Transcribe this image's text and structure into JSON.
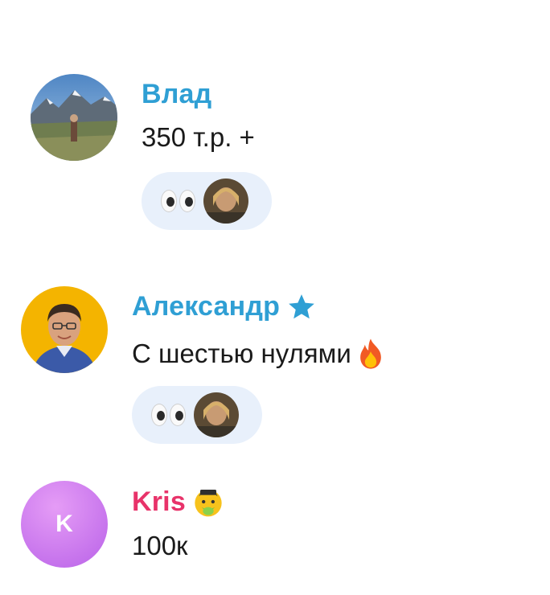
{
  "colors": {
    "name_blue": "#2f9fd4",
    "name_pink": "#e8336a",
    "reaction_bg": "#e8f0fb"
  },
  "messages": [
    {
      "author": "Влад",
      "text": "350 т.р. +",
      "avatar": "mountain-photo",
      "reaction": "eyes-emoji"
    },
    {
      "author": "Александр",
      "author_badge": "star-icon",
      "text": "С шестью нулями",
      "text_emoji": "fire-emoji",
      "avatar": "man-portrait",
      "reaction": "eyes-emoji"
    },
    {
      "author": "Kris",
      "author_badge": "sick-face-emoji",
      "text": "100к",
      "avatar_letter": "K"
    }
  ]
}
